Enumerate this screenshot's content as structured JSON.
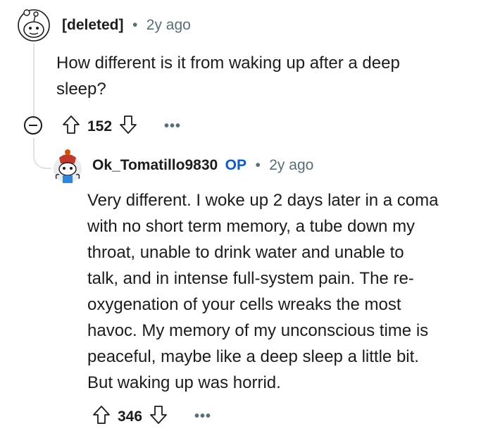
{
  "comment1": {
    "author": "[deleted]",
    "separator": "•",
    "time": "2y ago",
    "body_line1": "How different is it from waking up after a deep",
    "body_line2": "sleep?",
    "score": "152",
    "more_label": "•••",
    "avatar_icon": "deleted-user-avatar-icon"
  },
  "comment2": {
    "author": "Ok_Tomatillo9830",
    "op_badge": "OP",
    "separator": "•",
    "time": "2y ago",
    "lines": [
      "Very different. I woke up 2 days later in a coma",
      "with no short term memory, a tube down my",
      "throat, unable to drink water and unable to",
      "talk, and in intense full-system pain. The re-",
      "oxygenation of your cells wreaks the most",
      "havoc. My memory of my unconscious time is",
      "peaceful, maybe like a deep sleep a little bit.",
      "But waking up was horrid."
    ],
    "score": "346",
    "more_label": "•••",
    "avatar_icon": "snoo-avatar-icon"
  },
  "colors": {
    "text": "#1c1c1c",
    "meta": "#576f76",
    "op": "#0a5bd6",
    "thread": "#dfe2e5"
  }
}
